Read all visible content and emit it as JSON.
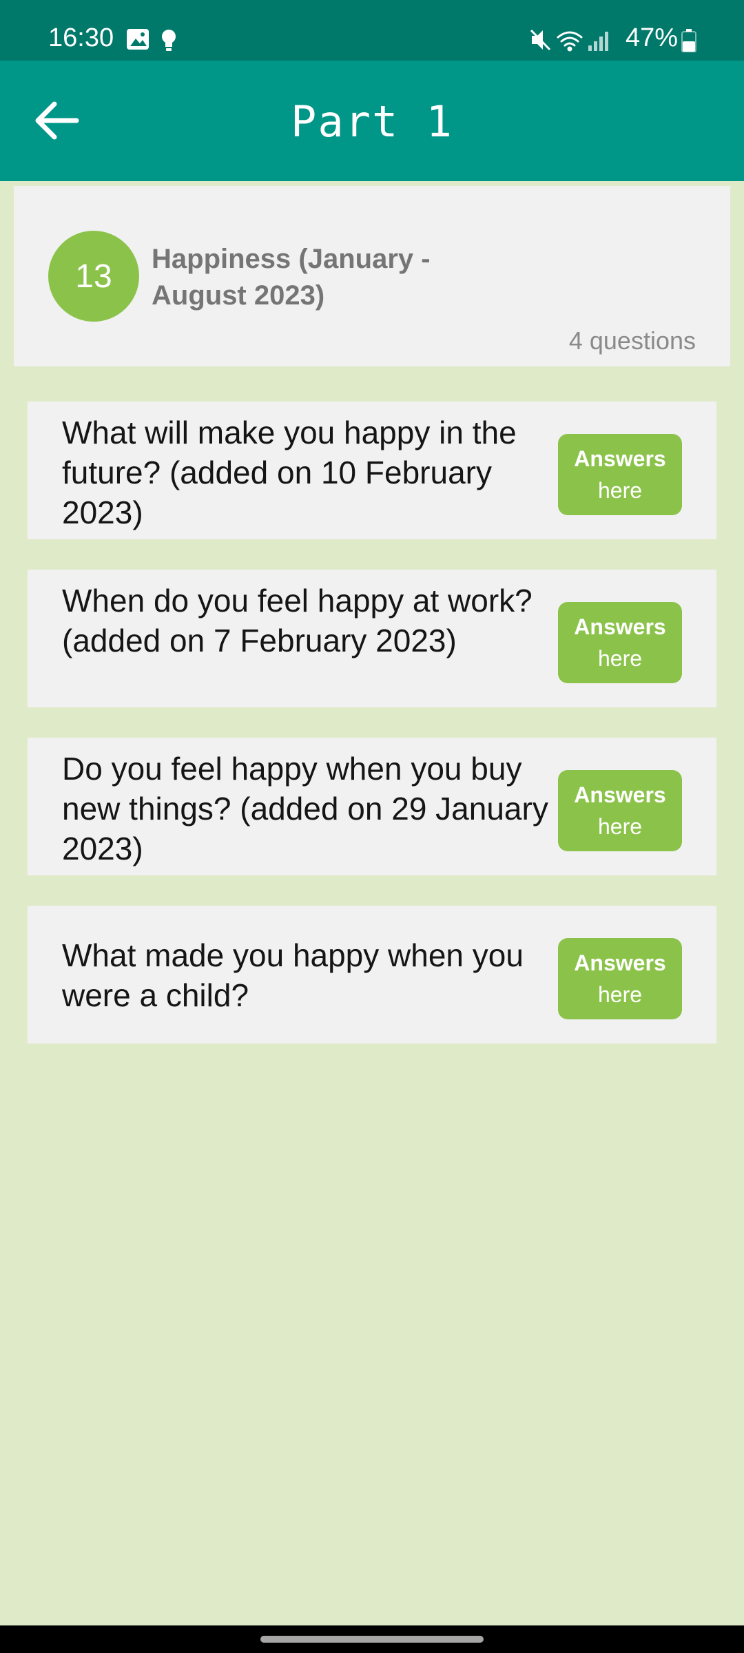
{
  "status_bar": {
    "time": "16:30",
    "battery": "47%",
    "icons": [
      "image-icon",
      "lightbulb-icon",
      "mute-icon",
      "wifi-icon",
      "signal-icon",
      "battery-icon"
    ]
  },
  "app_bar": {
    "title": "Part 1",
    "back_icon": "back-arrow-icon"
  },
  "header": {
    "badge_number": "13",
    "title": "Happiness (January - August 2023)",
    "question_count": "4 questions"
  },
  "questions": [
    {
      "text": "What will make you happy in the future? (added on 10 February 2023)",
      "button_line1": "Answers",
      "button_line2": "here"
    },
    {
      "text": "When do you feel happy at work? (added on 7 February 2023)",
      "button_line1": "Answers",
      "button_line2": "here"
    },
    {
      "text": "Do you feel happy when you buy new things? (added on 29 January 2023)",
      "button_line1": "Answers",
      "button_line2": "here"
    },
    {
      "text": "What made you happy when you were a child?",
      "button_line1": "Answers",
      "button_line2": "here"
    }
  ],
  "colors": {
    "status_bar": "#00796b",
    "app_bar": "#009688",
    "accent_green": "#8bc34a",
    "background": "#dfebc8",
    "card": "#f1f1f1"
  }
}
